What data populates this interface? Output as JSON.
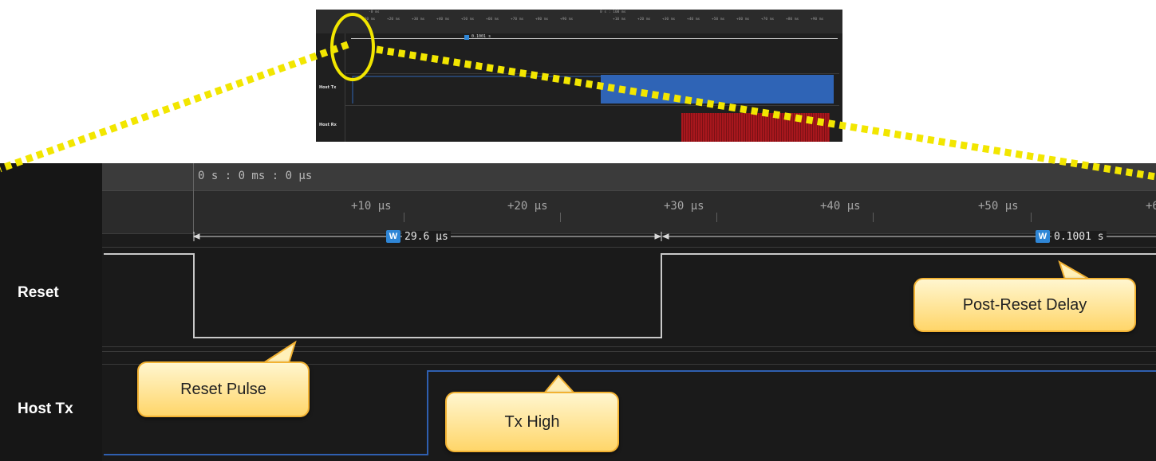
{
  "overview": {
    "header_left": "-0 ms",
    "header_center": "0 s : 100 ms",
    "ticks": [
      "+10 ms",
      "+20 ms",
      "+30 ms",
      "+40 ms",
      "+50 ms",
      "+60 ms",
      "+70 ms",
      "+80 ms",
      "+90 ms",
      "+10 ms",
      "+20 ms",
      "+30 ms",
      "+40 ms",
      "+50 ms",
      "+60 ms",
      "+70 ms",
      "+80 ms",
      "+90 ms"
    ],
    "measurement": "0.1001 s",
    "channels": [
      "Host Tx",
      "Host Rx"
    ],
    "colors": {
      "tx": "#2f64b6",
      "rx": "#a8171d",
      "highlight": "#f2e600"
    }
  },
  "timeline": {
    "origin": "0 s : 0 ms : 0 µs",
    "ticks": [
      "+10 µs",
      "+20 µs",
      "+30 µs",
      "+40 µs",
      "+50 µs",
      "+6"
    ]
  },
  "measurements": [
    {
      "badge": "W",
      "value": "29.6 µs"
    },
    {
      "badge": "W",
      "value": "0.1001 s"
    }
  ],
  "channels": {
    "reset": "Reset",
    "host_tx": "Host Tx"
  },
  "callouts": {
    "post_reset": "Post-Reset Delay",
    "reset_pulse": "Reset Pulse",
    "tx_high": "Tx High"
  },
  "colors": {
    "reset_wave": "#c9c9c9",
    "tx_wave": "#2f5fb0",
    "badge": "#2f86d6"
  }
}
